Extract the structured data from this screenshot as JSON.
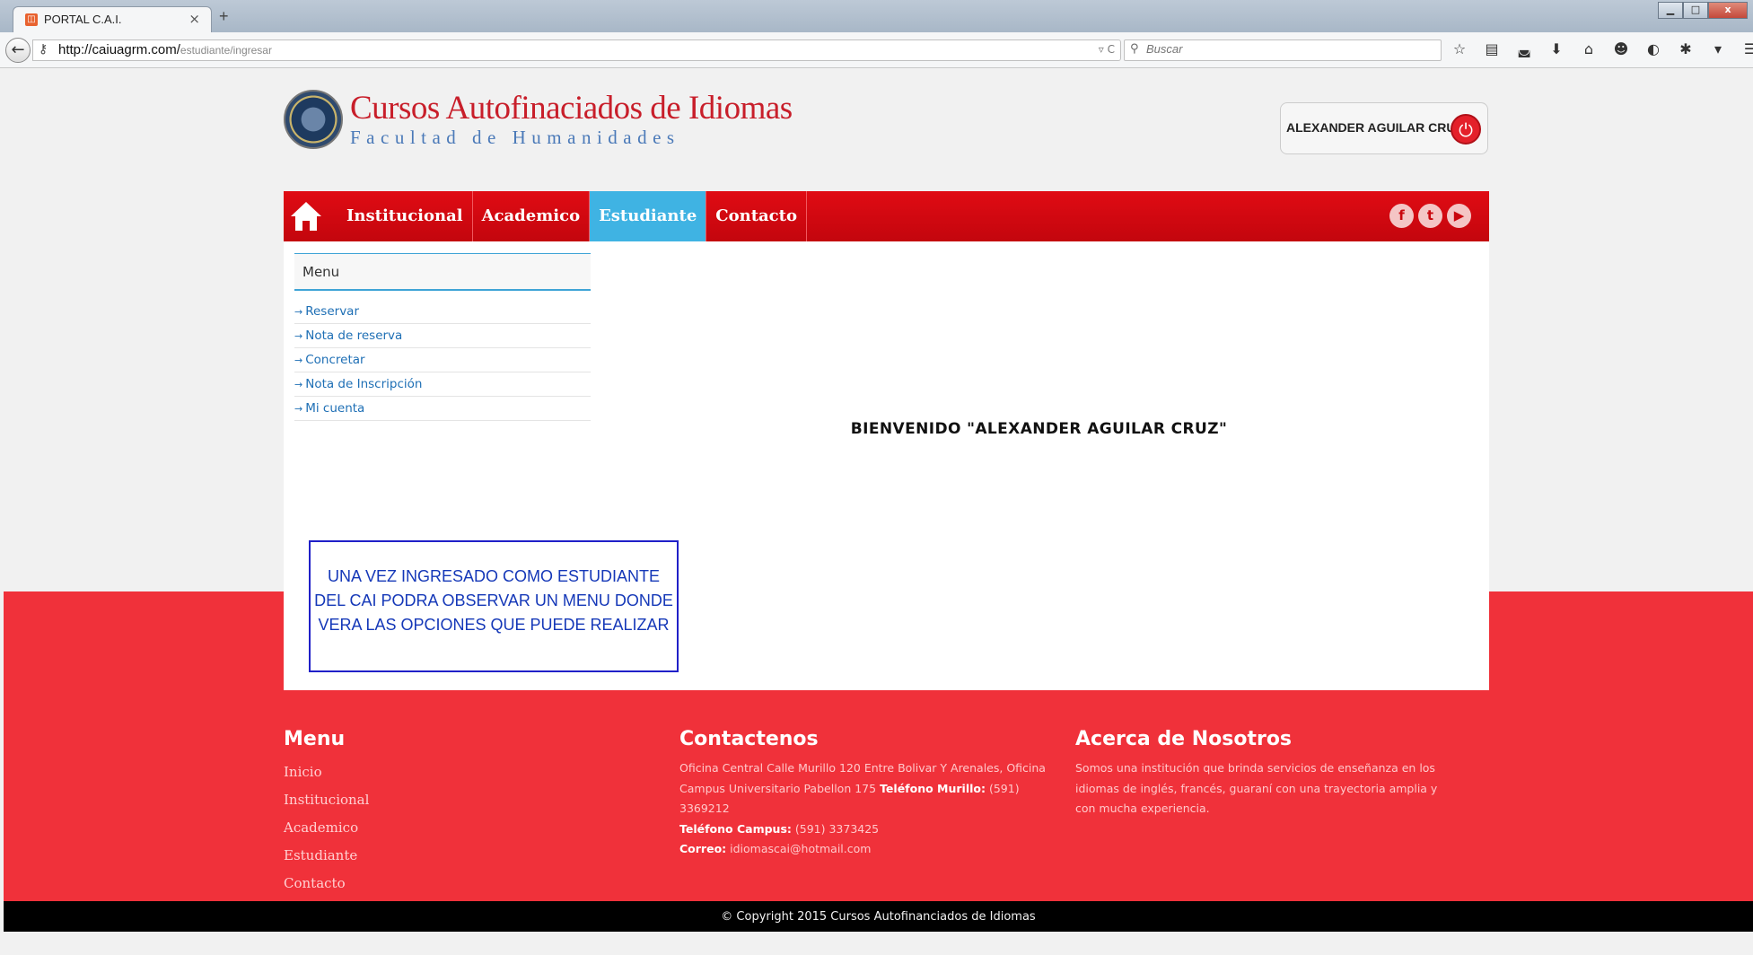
{
  "browser": {
    "tab_title": "PORTAL C.A.I.",
    "tab_close": "×",
    "new_tab": "+",
    "url_host": "http://caiuagrm.com/",
    "url_path": "estudiante/ingresar",
    "url_actions": "▿ C",
    "search_placeholder": "Buscar",
    "window_controls": [
      "▁",
      "□",
      "x"
    ],
    "toolbar_icons": [
      "☆",
      "▤",
      "◛",
      "⬇",
      "⌂",
      "☻",
      "◐",
      "✱",
      "▾",
      "☰"
    ]
  },
  "header": {
    "logo_title": "Cursos Autofinaciados de Idiomas",
    "logo_subtitle": "Facultad de Humanidades",
    "user_name": "ALEXANDER AGUILAR CRUZ",
    "power_icon": "⏻"
  },
  "nav": {
    "items": [
      "Institucional",
      "Academico",
      "Estudiante",
      "Contacto"
    ],
    "active": "Estudiante",
    "social": [
      "f",
      "t",
      "▶"
    ]
  },
  "sidebar": {
    "title": "Menu",
    "arrow": "→",
    "items": [
      "Reservar",
      "Nota de reserva",
      "Concretar",
      "Nota de Inscripción",
      "Mi cuenta"
    ]
  },
  "main": {
    "welcome": "BIENVENIDO \"ALEXANDER AGUILAR CRUZ\"",
    "note": "UNA VEZ INGRESADO COMO ESTUDIANTE DEL CAI PODRA OBSERVAR UN MENU DONDE VERA LAS OPCIONES QUE PUEDE REALIZAR"
  },
  "footer": {
    "menu_title": "Menu",
    "menu_links": [
      "Inicio",
      "Institucional",
      "Academico",
      "Estudiante",
      "Contacto"
    ],
    "contact_title": "Contactenos",
    "contact_address": "Oficina Central Calle Murillo 120 Entre Bolivar Y Arenales, Oficina Campus Universitario Pabellon 175",
    "contact_phone_murillo_label": "Teléfono Murillo:",
    "contact_phone_murillo": "(591) 3369212",
    "contact_phone_campus_label": "Teléfono Campus:",
    "contact_phone_campus": "(591) 3373425",
    "contact_email_label": "Correo:",
    "contact_email": "idiomascai@hotmail.com",
    "about_title": "Acerca de Nosotros",
    "about_text": "Somos una institución que brinda servicios de enseñanza en los idiomas de inglés, francés, guaraní con una trayectoria amplia y con mucha experiencia.",
    "copyright": "© Copyright 2015 Cursos Autofinanciados de Idiomas"
  },
  "colors": {
    "brand_red": "#e00c14",
    "active_tab_blue": "#3fb3e3",
    "footer_red": "#f0313a",
    "note_border": "#2020c8"
  }
}
